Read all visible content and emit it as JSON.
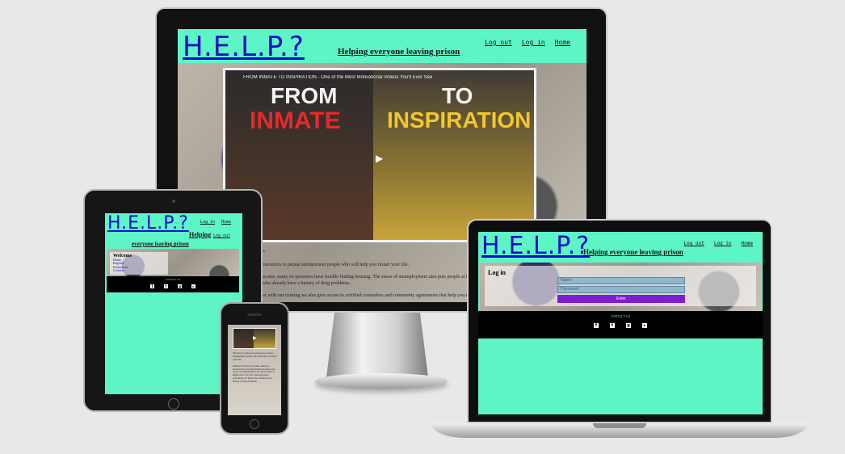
{
  "site": {
    "logo": "H.E.L.P.?",
    "tagline": "Helping everyone leaving prison",
    "tagline_tablet_1": "Helping",
    "tagline_tablet_2": "everyone leaving prison",
    "nav": {
      "logout": "Log out",
      "login": "Log in",
      "home": "Home"
    }
  },
  "video": {
    "title": "FROM INMATE TO INSPIRATION - One of the Most Motivational Videos You'll Ever See",
    "line1_left": "FROM",
    "line2_left": "INMATE",
    "line1_right": "TO",
    "line2_right": "INSPIRATION"
  },
  "desktop_text": {
    "caption": "ides",
    "p1": "ou resources to pursue entrepreneur people who will help you restart your life.",
    "p2": "d income, many ex-prisoners have trouble finding housing. The stress of unemployment also puts people at high",
    "p3": "se who already have a history of drug problems.",
    "p4": "enter with our trusting we also give access to certified counselors and community agreements that help you to"
  },
  "tablet": {
    "welcome": "Welcome",
    "links": [
      "Home",
      "Register",
      "Instructions",
      "Contacts"
    ]
  },
  "phone_text": {
    "p1": "The site is to give you resources to pursue entrepreneur people who will help you restart your life.",
    "p2": "Without a source of income, many ex-prisoners have trouble finding housing. The stress of unemployment also puts people at higher risk of alcohol and drug abuse, particularly for those who already have a history of drug problems."
  },
  "laptop": {
    "heading": "Log in",
    "username_placeholder": "Name",
    "password_placeholder": "Password",
    "enter_label": "Enter"
  },
  "footer": {
    "contact": "CONTACT US"
  },
  "social_icons": [
    "facebook-icon",
    "twitter-icon",
    "google-plus-icon",
    "youtube-icon"
  ],
  "colors": {
    "site_bg": "#5ef5c6",
    "logo": "#0d0dcc",
    "enter_button": "#7b1fd1",
    "footer": "#000000"
  }
}
